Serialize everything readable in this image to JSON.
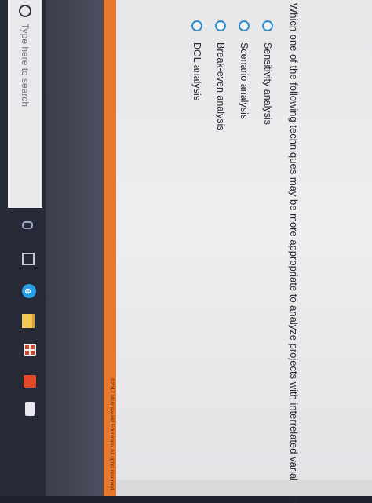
{
  "question": {
    "text": "Which one of the following techniques may be more appropriate to analyze projects with interrelated variables?"
  },
  "options": [
    {
      "label": "Sensitivity analysis",
      "selected": false
    },
    {
      "label": "Scenario analysis",
      "selected": false
    },
    {
      "label": "Break-even analysis",
      "selected": false
    },
    {
      "label": "DOL analysis",
      "selected": false
    }
  ],
  "footer": {
    "copyright": "©2017 McGraw-Hill Education. All rights reserved.",
    "bar_color": "#e8782f"
  },
  "taskbar": {
    "search_placeholder": "Type here to search",
    "icons": [
      "search-icon",
      "microphone-icon",
      "task-view-icon",
      "edge-browser-icon",
      "file-explorer-icon",
      "store-icon",
      "office-icon",
      "mail-icon"
    ]
  },
  "colors": {
    "radio_accent": "#2f8fcf",
    "taskbar": "#262a37"
  }
}
